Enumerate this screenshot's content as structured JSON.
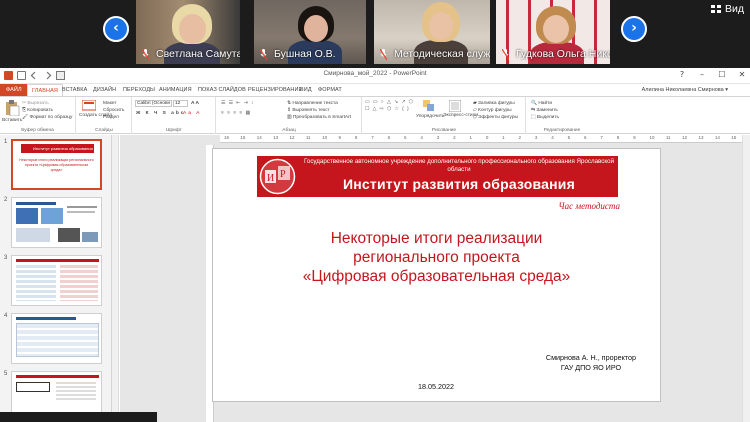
{
  "video_call": {
    "participants": [
      {
        "name": "Светлана Самута"
      },
      {
        "name": "Бушная О.В."
      },
      {
        "name": "Методическая служб..."
      },
      {
        "name": "Гудкова Ольга Нико..."
      }
    ],
    "view_label": "Вид",
    "prev_arrow": "‹",
    "next_arrow": "›"
  },
  "powerpoint": {
    "window_title": "Смирнова_мой_2022 - PowerPoint",
    "user": "Алилина Николаевна Смирнова ▾",
    "window_controls": [
      "?",
      "–",
      "☐",
      "✕"
    ],
    "tabs": [
      "ФАЙЛ",
      "ГЛАВНАЯ",
      "ВСТАВКА",
      "ДИЗАЙН",
      "ПЕРЕХОДЫ",
      "АНИМАЦИЯ",
      "ПОКАЗ СЛАЙДОВ",
      "РЕЦЕНЗИРОВАНИЕ",
      "ВИД",
      "ФОРМАТ"
    ],
    "active_tab": "ГЛАВНАЯ",
    "ribbon": {
      "clipboard": {
        "label": "Буфер обмена",
        "paste": "Вставить",
        "cut": "Вырезать",
        "copy": "Копировать",
        "format": "Формат по образцу"
      },
      "slides": {
        "label": "Слайды",
        "new": "Создать слайд",
        "layout": "Макет",
        "reset": "Сбросить",
        "section": "Раздел"
      },
      "font": {
        "label": "Шрифт",
        "font_name": "Calibri (Основн",
        "font_size": "12"
      },
      "paragraph": {
        "label": "Абзац",
        "direction": "Направление текста",
        "align": "Выровнять текст",
        "smartart": "Преобразовать в SmartArt"
      },
      "drawing": {
        "label": "Рисование",
        "arrange": "Упорядочить",
        "styles": "Экспресс-стили",
        "fill": "Заливка фигуры",
        "outline": "Контур фигуры",
        "effects": "Эффекты фигуры"
      },
      "editing": {
        "label": "Редактирование",
        "find": "Найти",
        "replace": "Заменить",
        "select": "Выделить"
      }
    },
    "thumbnails": [
      {
        "num": "1",
        "title": "Институт развития образования",
        "subtitle": "Некоторые итоги реализации регионального проекта «Цифровая образовательная среда»"
      },
      {
        "num": "2"
      },
      {
        "num": "3"
      },
      {
        "num": "4"
      },
      {
        "num": "5"
      }
    ],
    "ruler_ticks": [
      "16",
      "15",
      "14",
      "13",
      "12",
      "11",
      "10",
      "9",
      "8",
      "7",
      "6",
      "5",
      "4",
      "3",
      "2",
      "1",
      "0",
      "1",
      "2",
      "3",
      "4",
      "5",
      "6",
      "7",
      "8",
      "9",
      "10",
      "11",
      "12",
      "13",
      "14",
      "15",
      "16"
    ],
    "slide": {
      "banner_top": "Государственное автономное учреждение дополнительного профессионального образования Ярославской области",
      "banner_main": "Институт развития образования",
      "logo_text": "ИРО",
      "subtitle": "Час методиста",
      "title_lines": [
        "Некоторые итоги реализации",
        "регионального проекта",
        "«Цифровая образовательная среда»"
      ],
      "author_lines": [
        "Смирнова А. Н., проректор",
        "ГАУ ДПО ЯО ИРО"
      ],
      "date": "18.05.2022"
    }
  },
  "colors": {
    "accent": "#d24726",
    "brand_red": "#c4161c",
    "call_blue": "#1a73e8"
  }
}
